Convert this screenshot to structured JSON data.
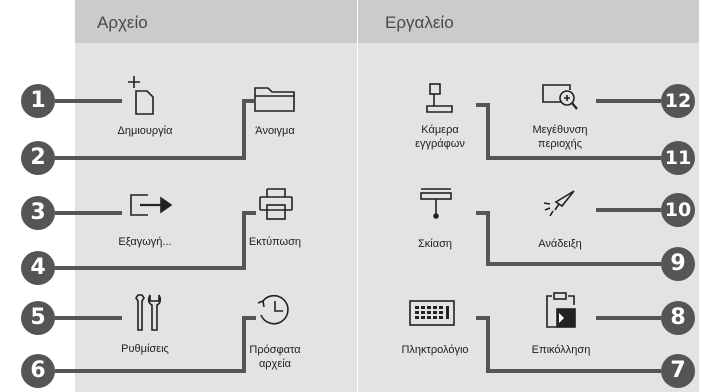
{
  "header": {
    "file": "Αρχείο",
    "tools": "Εργαλείο"
  },
  "items": {
    "new": "Δημιουργία",
    "open": "Άνοιγμα",
    "export": "Εξαγωγή...",
    "print": "Εκτύπωση",
    "settings": "Ρυθμίσεις",
    "recent_1": "Πρόσφατα",
    "recent_2": "αρχεία",
    "camera_1": "Κάμερα",
    "camera_2": "εγγράφων",
    "zoom_1": "Μεγέθυνση",
    "zoom_2": "περιοχής",
    "shade": "Σκίαση",
    "highlight": "Ανάδειξη",
    "keyboard": "Πληκτρολόγιο",
    "paste": "Επικόλληση"
  },
  "callouts": [
    "1",
    "2",
    "3",
    "4",
    "5",
    "6",
    "7",
    "8",
    "9",
    "10",
    "11",
    "12"
  ]
}
